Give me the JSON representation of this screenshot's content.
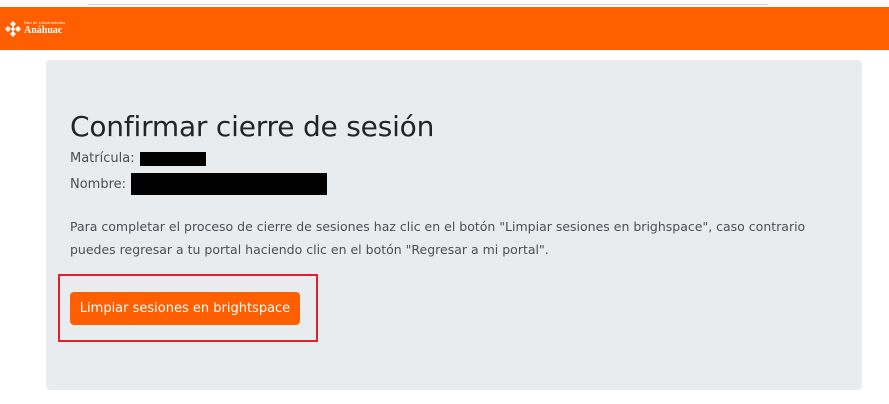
{
  "header": {
    "brand_sub": "Red de Universidades",
    "brand_name": "Anáhuac",
    "brand_color": "#ff5f00"
  },
  "main": {
    "title": "Confirmar cierre de sesión",
    "matricula_label": "Matrícula:",
    "nombre_label": "Nombre:",
    "instructions": "Para completar el proceso de cierre de sesiones haz clic en el botón \"Limpiar sesiones en brighspace\", caso contrario puedes regresar a tu portal haciendo clic en el botón \"Regresar a mi portal\".",
    "clear_button_label": "Limpiar sesiones en brightspace"
  }
}
